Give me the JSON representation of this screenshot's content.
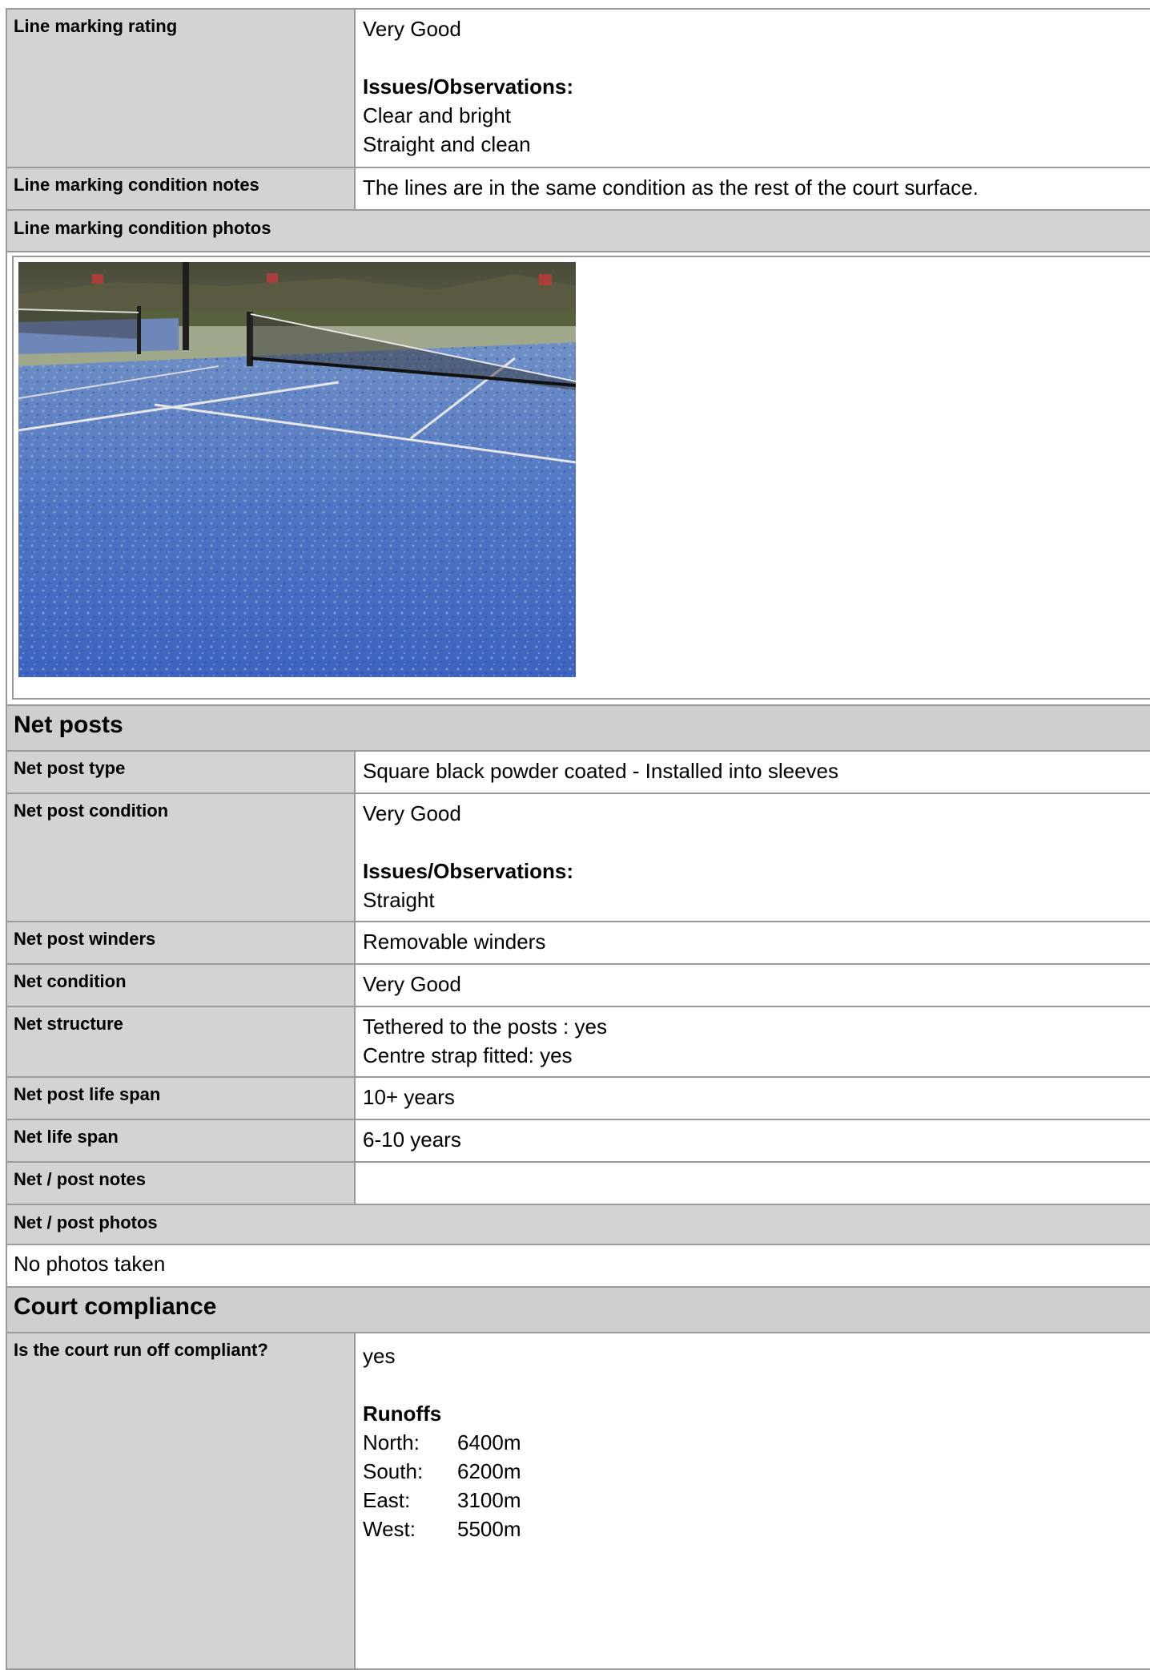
{
  "line_marking": {
    "rating_label": "Line marking rating",
    "rating_value": "Very Good",
    "issues_title": "Issues/Observations:",
    "issues": [
      "Clear and bright",
      "Straight and clean"
    ],
    "notes_label": "Line marking condition notes",
    "notes_value": "The lines are in the same condition as the rest of the court surface.",
    "photos_label": "Line marking condition photos"
  },
  "net_posts": {
    "section_title": "Net posts",
    "type_label": "Net post type",
    "type_value": "Square black powder coated - Installed into sleeves",
    "condition_label": "Net post condition",
    "condition_value": "Very Good",
    "issues_title": "Issues/Observations:",
    "issues": [
      "Straight"
    ],
    "winders_label": "Net post winders",
    "winders_value": "Removable winders",
    "net_condition_label": "Net condition",
    "net_condition_value": "Very Good",
    "structure_label": "Net structure",
    "structure_lines": [
      "Tethered to the posts : yes",
      "Centre strap fitted: yes"
    ],
    "post_life_label": "Net post life span",
    "post_life_value": "10+ years",
    "net_life_label": "Net life span",
    "net_life_value": "6-10 years",
    "notes_label": "Net / post notes",
    "notes_value": "",
    "photos_label": "Net / post photos",
    "photos_value": "No photos taken"
  },
  "court_compliance": {
    "section_title": "Court compliance",
    "runoff_label": "Is the court run off compliant?",
    "runoff_value": "yes",
    "runoffs_title": "Runoffs",
    "runoffs": [
      {
        "dir": "North:",
        "value": "6400m"
      },
      {
        "dir": "South:",
        "value": "6200m"
      },
      {
        "dir": "East:",
        "value": "3100m"
      },
      {
        "dir": "West:",
        "value": "5500m"
      }
    ]
  }
}
